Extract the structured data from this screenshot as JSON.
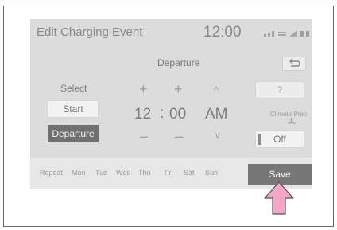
{
  "screen": {
    "title": "Edit Charging Event",
    "clock": "12:00",
    "status_icons": [
      "signal-icon",
      "battery-icon"
    ]
  },
  "panel": {
    "label": "Departure",
    "back_icon": "back-arrow-icon"
  },
  "select": {
    "label": "Select",
    "start": "Start",
    "departure": "Departure"
  },
  "time": {
    "hour": "12",
    "separator": ":",
    "minute": "00",
    "ampm": "AM",
    "plus": "+",
    "minus": "–",
    "up": "^",
    "down": "v"
  },
  "right": {
    "help": "?",
    "climate_label": "Climate Prep",
    "climate_icon": "fan-icon",
    "toggle": "Off"
  },
  "days": {
    "repeat": "Repeat",
    "list": [
      "Mon",
      "Tue",
      "Wed",
      "Thu",
      "Fri",
      "Sat",
      "Sun"
    ]
  },
  "save": "Save",
  "colors": {
    "screen_bg": "#dcdcdc",
    "selected_bg": "#707070",
    "pointer_arrow": "#f4a6c8"
  }
}
